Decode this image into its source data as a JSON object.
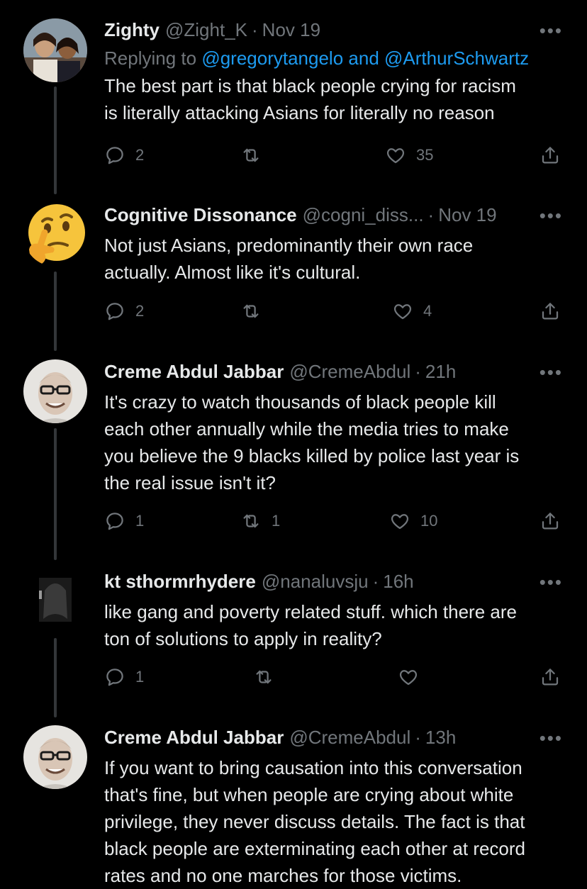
{
  "tweets": [
    {
      "name": "Zighty",
      "handle": "@Zight_K",
      "time": "Nov 19",
      "replying_prefix": "Replying to ",
      "mention1": "@gregorytangelo",
      "replying_and": " and ",
      "mention2": "@ArthurSchwartz",
      "lines": [
        "The best part is that black people crying for racism",
        "is literally attacking Asians for literally no reason"
      ],
      "replies": "2",
      "retweets": "",
      "likes": "35",
      "avatar": "photo-avatar"
    },
    {
      "name": "Cognitive Dissonance",
      "handle": "@cogni_diss...",
      "time": "Nov 19",
      "lines": [
        "Not just Asians, predominantly their own race",
        "actually. Almost like it's cultural."
      ],
      "replies": "2",
      "retweets": "",
      "likes": "4",
      "avatar": "thinking-face-emoji"
    },
    {
      "name": "Creme Abdul Jabbar",
      "handle": "@CremeAbdul",
      "time": "21h",
      "lines": [
        "It's crazy to watch thousands of black people kill",
        "each other annually while the media tries to make",
        "you believe the 9 blacks killed by police last year is",
        "the real issue isn't it?"
      ],
      "replies": "1",
      "retweets": "1",
      "likes": "10",
      "avatar": "glasses-man-avatar"
    },
    {
      "name": "kt sthormrhydere",
      "handle": "@nanaluvsju",
      "time": "16h",
      "lines": [
        "like gang and poverty related stuff. which there are",
        "ton of solutions to apply in reality?"
      ],
      "replies": "1",
      "retweets": "",
      "likes": "",
      "avatar": "dark-photo-avatar"
    },
    {
      "name": "Creme Abdul Jabbar",
      "handle": "@CremeAbdul",
      "time": "13h",
      "lines": [
        "If you want to bring causation into this conversation",
        "that's fine, but when people are crying about white",
        "privilege, they never discuss details. The fact is that",
        "black people are exterminating each other at record",
        "rates and no one marches for those victims."
      ],
      "avatar": "glasses-man-avatar"
    }
  ],
  "dot": "·",
  "more": "•••",
  "icons": {
    "reply": "reply-icon",
    "retweet": "retweet-icon",
    "like": "like-icon",
    "share": "share-icon"
  },
  "colors": {
    "background": "#000000",
    "text": "#e7e9ea",
    "muted": "#71767b",
    "link": "#1d9bf0"
  }
}
